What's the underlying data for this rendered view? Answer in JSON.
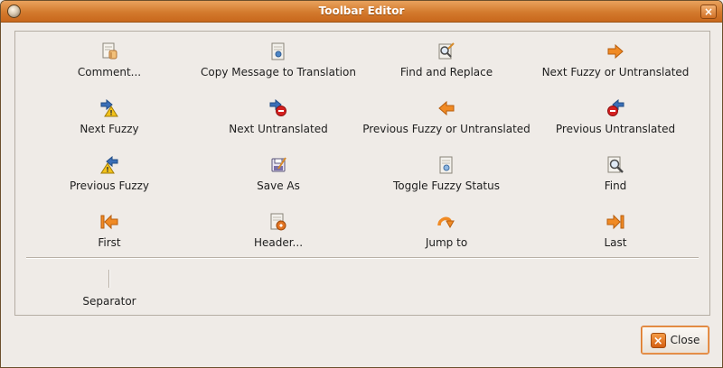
{
  "window": {
    "title": "Toolbar Editor",
    "close_glyph": "×"
  },
  "toolbar_items": [
    {
      "label": "Comment...",
      "icon": "comment-icon"
    },
    {
      "label": "Copy Message to Translation",
      "icon": "copy-message-icon"
    },
    {
      "label": "Find and Replace",
      "icon": "find-replace-icon"
    },
    {
      "label": "Next Fuzzy or Untranslated",
      "icon": "arrow-right-icon"
    },
    {
      "label": "Next Fuzzy",
      "icon": "next-fuzzy-icon"
    },
    {
      "label": "Next Untranslated",
      "icon": "next-untranslated-icon"
    },
    {
      "label": "Previous Fuzzy or Untranslated",
      "icon": "arrow-left-icon"
    },
    {
      "label": "Previous Untranslated",
      "icon": "previous-untranslated-icon"
    },
    {
      "label": "Previous Fuzzy",
      "icon": "previous-fuzzy-icon"
    },
    {
      "label": "Save As",
      "icon": "save-as-icon"
    },
    {
      "label": "Toggle Fuzzy Status",
      "icon": "toggle-fuzzy-icon"
    },
    {
      "label": "Find",
      "icon": "find-icon"
    },
    {
      "label": "First",
      "icon": "first-icon"
    },
    {
      "label": "Header...",
      "icon": "header-icon"
    },
    {
      "label": "Jump to",
      "icon": "jump-to-icon"
    },
    {
      "label": "Last",
      "icon": "last-icon"
    }
  ],
  "separator": {
    "label": "Separator"
  },
  "close_button": {
    "label": "Close",
    "glyph": "×"
  },
  "colors": {
    "title_bar": "#d37a2d",
    "arrow_orange": "#f08a24",
    "arrow_blue": "#3a6fb8",
    "stop_red": "#d42020",
    "warning_yellow": "#f2c21b"
  }
}
